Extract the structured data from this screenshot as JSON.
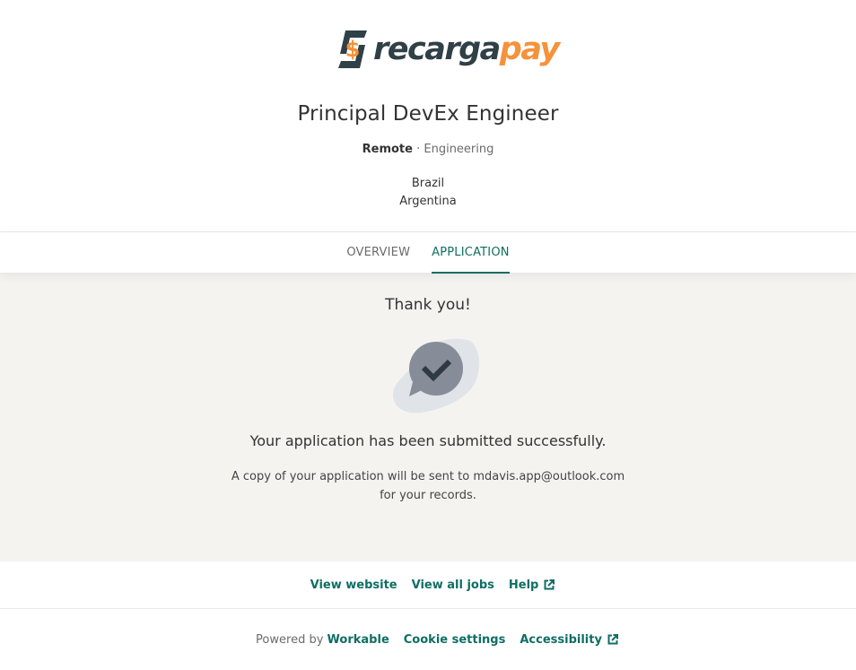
{
  "brand": {
    "logo_text_primary": "recarga",
    "logo_text_accent": "pay",
    "logo_symbol": "$",
    "colors": {
      "dark": "#2f4047",
      "accent": "#f5923a",
      "link": "#0f6e63"
    }
  },
  "job": {
    "title": "Principal DevEx Engineer",
    "workplace": "Remote",
    "separator": " · ",
    "department": "Engineering",
    "locations": [
      "Brazil",
      "Argentina"
    ]
  },
  "tabs": [
    {
      "label": "OVERVIEW",
      "active": false
    },
    {
      "label": "APPLICATION",
      "active": true
    }
  ],
  "confirmation": {
    "heading": "Thank you!",
    "icon": "chat-check-icon",
    "message": "Your application has been submitted successfully.",
    "copy_line1": "A copy of your application will be sent to mdavis.app@outlook.com",
    "copy_line2": "for your records."
  },
  "footer": {
    "links": [
      {
        "label": "View website",
        "external": false
      },
      {
        "label": "View all jobs",
        "external": false
      },
      {
        "label": "Help",
        "external": true
      }
    ],
    "powered_by_label": "Powered by",
    "powered_by_brand": "Workable",
    "cookie_settings": "Cookie settings",
    "accessibility": "Accessibility"
  }
}
